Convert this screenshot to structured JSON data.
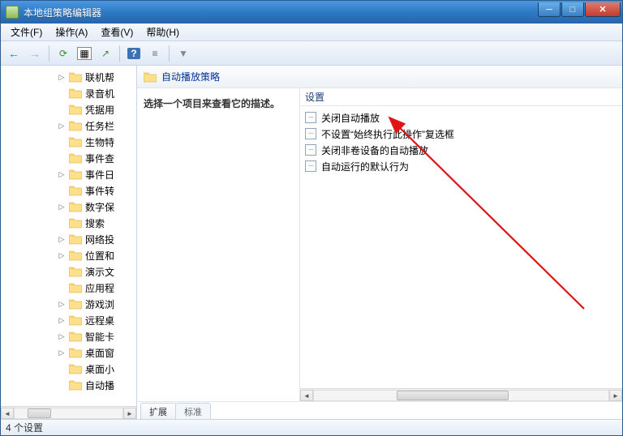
{
  "window": {
    "title": "本地组策略编辑器"
  },
  "menubar": [
    {
      "label": "文件(F)"
    },
    {
      "label": "操作(A)"
    },
    {
      "label": "查看(V)"
    },
    {
      "label": "帮助(H)"
    }
  ],
  "toolbar_icons": {
    "back": "←",
    "forward": "→",
    "refresh": "⟳",
    "props": "▦",
    "export": "↗",
    "help": "?",
    "filter1": "≡",
    "filter2": "▼"
  },
  "tree": [
    {
      "expander": "▷",
      "label": "联机帮"
    },
    {
      "expander": "",
      "label": "录音机"
    },
    {
      "expander": "",
      "label": "凭据用"
    },
    {
      "expander": "▷",
      "label": "任务栏"
    },
    {
      "expander": "",
      "label": "生物特"
    },
    {
      "expander": "",
      "label": "事件查"
    },
    {
      "expander": "▷",
      "label": "事件日"
    },
    {
      "expander": "",
      "label": "事件转"
    },
    {
      "expander": "▷",
      "label": "数字保"
    },
    {
      "expander": "",
      "label": "搜索"
    },
    {
      "expander": "▷",
      "label": "网络投"
    },
    {
      "expander": "▷",
      "label": "位置和"
    },
    {
      "expander": "",
      "label": "演示文"
    },
    {
      "expander": "",
      "label": "应用程"
    },
    {
      "expander": "▷",
      "label": "游戏浏"
    },
    {
      "expander": "▷",
      "label": "远程桌"
    },
    {
      "expander": "▷",
      "label": "智能卡"
    },
    {
      "expander": "▷",
      "label": "桌面窗"
    },
    {
      "expander": "",
      "label": "桌面小"
    },
    {
      "expander": "",
      "label": "自动播"
    }
  ],
  "header": {
    "path_title": "自动播放策略"
  },
  "description": {
    "text": "选择一个项目来查看它的描述。"
  },
  "settings": {
    "column_header": "设置",
    "items": [
      {
        "label": "关闭自动播放"
      },
      {
        "label": "不设置“始终执行此操作”复选框"
      },
      {
        "label": "关闭非卷设备的自动播放"
      },
      {
        "label": "自动运行的默认行为"
      }
    ]
  },
  "tabs": {
    "extended": "扩展",
    "standard": "标准"
  },
  "statusbar": {
    "text": "4 个设置"
  },
  "left_scrollbar": {
    "thumb_left_pct": 12,
    "thumb_width_pct": 22
  },
  "right_scrollbar": {
    "thumb_left_pct": 28,
    "thumb_width_pct": 38
  }
}
